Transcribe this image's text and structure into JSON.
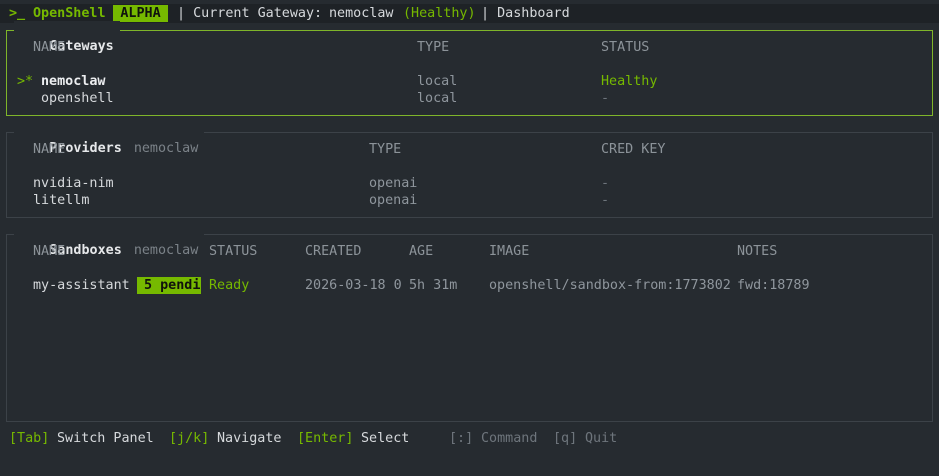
{
  "header": {
    "prompt": ">_",
    "app_name": "OpenShell",
    "badge": "ALPHA",
    "gateway_prefix": "| Current Gateway: ",
    "gateway_name": "nemoclaw",
    "gateway_status": "(Healthy)",
    "view_suffix": "| Dashboard"
  },
  "gateways": {
    "title": "Gateways",
    "columns": [
      "NAME",
      "TYPE",
      "STATUS"
    ],
    "rows": [
      {
        "marker": ">*",
        "name": "nemoclaw",
        "type": "local",
        "status": "Healthy"
      },
      {
        "marker": "",
        "name": "openshell",
        "type": "local",
        "status": "-"
      }
    ]
  },
  "providers": {
    "title": "Providers",
    "context": "nemoclaw",
    "columns": [
      "NAME",
      "TYPE",
      "CRED KEY"
    ],
    "rows": [
      {
        "name": "nvidia-nim",
        "type": "openai",
        "cred_key": "-"
      },
      {
        "name": "litellm",
        "type": "openai",
        "cred_key": "-"
      }
    ]
  },
  "sandboxes": {
    "title": "Sandboxes",
    "context": "nemoclaw",
    "columns": [
      "NAME",
      "STATUS",
      "CREATED",
      "AGE",
      "IMAGE",
      "NOTES"
    ],
    "rows": [
      {
        "name": "my-assistant",
        "pending_badge": "5 pendi",
        "status": "Ready",
        "created": "2026-03-18 0",
        "age": "5h 31m",
        "image": "openshell/sandbox-from:1773802",
        "notes": "fwd:18789"
      }
    ]
  },
  "footer": {
    "tab_key": "[Tab]",
    "tab_label": "Switch Panel",
    "nav_key": "[j/k]",
    "nav_label": "Navigate",
    "enter_key": "[Enter]",
    "enter_label": "Select",
    "cmd_key": "[:]",
    "cmd_label": "Command",
    "quit_key": "[q]",
    "quit_label": "Quit"
  },
  "colors": {
    "accent": "#76b900",
    "background": "#262b30",
    "active_border": "#7fb52a"
  }
}
